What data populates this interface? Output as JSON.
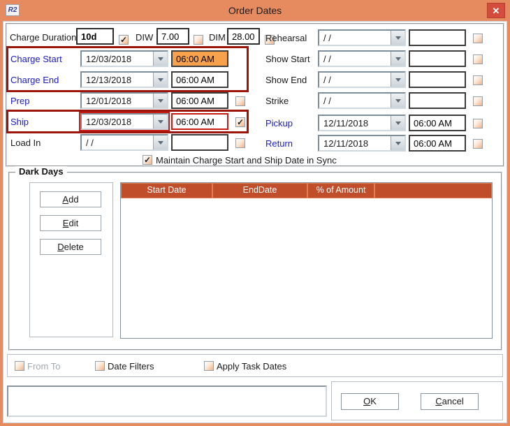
{
  "window": {
    "title": "Order Dates",
    "icon_text": "R2",
    "close_label": "✕"
  },
  "colors": {
    "titlebar": "#E68A60",
    "close_button": "#D34C3C",
    "table_header": "#C14E2B",
    "annotation_red": "#9B150C",
    "field_red_border": "#C91A12",
    "blue_label": "#1A1AC8",
    "time_selection": "#F7A14C"
  },
  "top_row": {
    "charge_duration_label": "Charge Duration",
    "charge_duration_value": "10d",
    "charge_duration_checked": true,
    "diw_label": "DIW",
    "diw_value": "7.00",
    "diw_checked": false,
    "dim_label": "DIM",
    "dim_value": "28.00",
    "dim_checked": false
  },
  "left_rows": [
    {
      "label": "Charge Start",
      "date": "12/03/2018",
      "time": "06:00 AM",
      "label_color": "blue",
      "time_highlighted": true,
      "has_checkbox": false
    },
    {
      "label": "Charge End",
      "date": "12/13/2018",
      "time": "06:00 AM",
      "label_color": "blue",
      "has_checkbox": false
    },
    {
      "label": "Prep",
      "date": "12/01/2018",
      "time": "06:00 AM",
      "label_color": "blue",
      "has_checkbox": true,
      "checked": false
    },
    {
      "label": "Ship",
      "date": "12/03/2018",
      "time": "06:00 AM",
      "label_color": "blue",
      "has_checkbox": true,
      "checked": true,
      "red_outline": true
    },
    {
      "label": "Load In",
      "date": "/ /",
      "time": "",
      "label_color": "black",
      "has_checkbox": true,
      "checked": false
    }
  ],
  "right_rows": [
    {
      "label": "Rehearsal",
      "date": "/ /",
      "time": "",
      "label_color": "black",
      "has_checkbox": true,
      "checked": false
    },
    {
      "label": "Show Start",
      "date": "/ /",
      "time": "",
      "label_color": "black",
      "has_checkbox": true,
      "checked": false
    },
    {
      "label": "Show End",
      "date": "/ /",
      "time": "",
      "label_color": "black",
      "has_checkbox": true,
      "checked": false
    },
    {
      "label": "Strike",
      "date": "/ /",
      "time": "",
      "label_color": "black",
      "has_checkbox": true,
      "checked": false
    },
    {
      "label": "Pickup",
      "date": "12/11/2018",
      "time": "06:00 AM",
      "label_color": "blue",
      "has_checkbox": true,
      "checked": false
    },
    {
      "label": "Return",
      "date": "12/11/2018",
      "time": "06:00 AM",
      "label_color": "blue",
      "has_checkbox": true,
      "checked": false
    }
  ],
  "sync": {
    "label": "Maintain Charge Start and Ship Date in Sync",
    "checked": true
  },
  "dark_days": {
    "title": "Dark Days",
    "buttons": [
      "Add",
      "Edit",
      "Delete"
    ],
    "columns": [
      "Start Date",
      "EndDate",
      "% of Amount"
    ],
    "rows": []
  },
  "filters": [
    {
      "label": "From To",
      "enabled": false,
      "checked": false
    },
    {
      "label": "Date Filters",
      "enabled": true,
      "checked": false
    },
    {
      "label": "Apply Task Dates",
      "enabled": true,
      "checked": false
    }
  ],
  "footer": {
    "note_value": "",
    "ok_label": "OK",
    "cancel_label": "Cancel"
  }
}
